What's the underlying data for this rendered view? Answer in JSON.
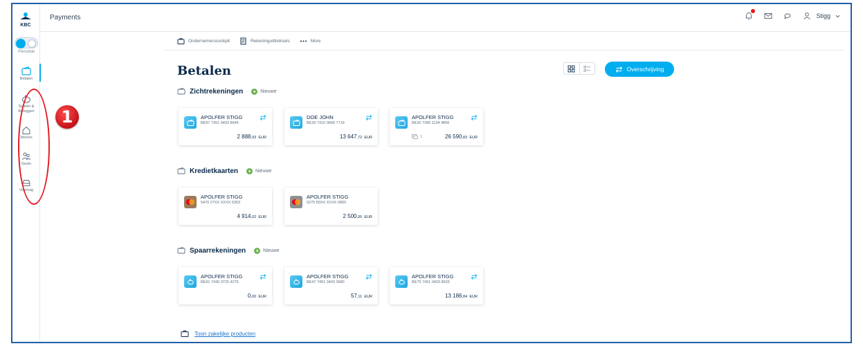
{
  "sidebar": {
    "logo_text": "KBC",
    "toggle_label": "Personal",
    "items": [
      {
        "label": "Betalen",
        "icon": "wallet-icon"
      },
      {
        "label": "Sparen & Beleggen",
        "icon": "piggy-bank-icon"
      },
      {
        "label": "Wonen",
        "icon": "house-icon"
      },
      {
        "label": "Gezin",
        "icon": "family-icon"
      },
      {
        "label": "Voertuig",
        "icon": "car-icon"
      }
    ]
  },
  "callout_number": "1",
  "header": {
    "title": "Payments",
    "user": "Stigg"
  },
  "subnav": [
    {
      "label": "Ondernemerscockpit",
      "icon": "briefcase-icon"
    },
    {
      "label": "Rekeninguittreksels",
      "icon": "document-icon"
    },
    {
      "label": "More",
      "icon": "more-dots-icon"
    }
  ],
  "page_title": "Betalen",
  "transfer_button": "Overschrijving",
  "colors": {
    "accent": "#00aeef",
    "navy": "#0b2a4a",
    "callout": "#e21b22",
    "add": "#6ab04c"
  },
  "sections": {
    "current": {
      "title": "Zichtrekeningen",
      "add_label": "Nieuwe",
      "cards": [
        {
          "name": "APOLFER STIGG",
          "iban": "BE97 7351 0403 8649",
          "amount_int": "2 888",
          "amount_dec": ",93",
          "currency": "EUR"
        },
        {
          "name": "DOE JOHN",
          "iban": "BE39 7310 0668 7719",
          "amount_int": "13 647",
          "amount_dec": ",72",
          "currency": "EUR"
        },
        {
          "name": "APOLFER STIGG",
          "iban": "BE20 7390 1134 4856",
          "amount_int": "26 590",
          "amount_dec": ",83",
          "currency": "EUR",
          "extra": "1"
        }
      ]
    },
    "credit": {
      "title": "Kredietkaarten",
      "add_label": "Nieuwe",
      "cards": [
        {
          "name": "APOLFER STIGG",
          "iban": "5470 27XX XXXX 6353",
          "amount_int": "4 914",
          "amount_dec": ",02",
          "currency": "EUR"
        },
        {
          "name": "APOLFER STIGG",
          "iban": "5275 83XX XXXX 0850",
          "amount_int": "2 500",
          "amount_dec": ",00",
          "currency": "EUR"
        }
      ]
    },
    "savings": {
      "title": "Spaarrekeningen",
      "add_label": "Nieuwe",
      "cards": [
        {
          "name": "APOLFER STIGG",
          "iban": "BE91 7430 3725 4276",
          "amount_int": "0",
          "amount_dec": ",00",
          "currency": "EUR"
        },
        {
          "name": "APOLFER STIGG",
          "iban": "BE47 7451 0403 3680",
          "amount_int": "57",
          "amount_dec": ",11",
          "currency": "EUR"
        },
        {
          "name": "APOLFER STIGG",
          "iban": "BE79 7451 0403 8633",
          "amount_int": "13 186",
          "amount_dec": ",84",
          "currency": "EUR"
        }
      ]
    }
  },
  "footer_link": "Toon zakelijke producten"
}
